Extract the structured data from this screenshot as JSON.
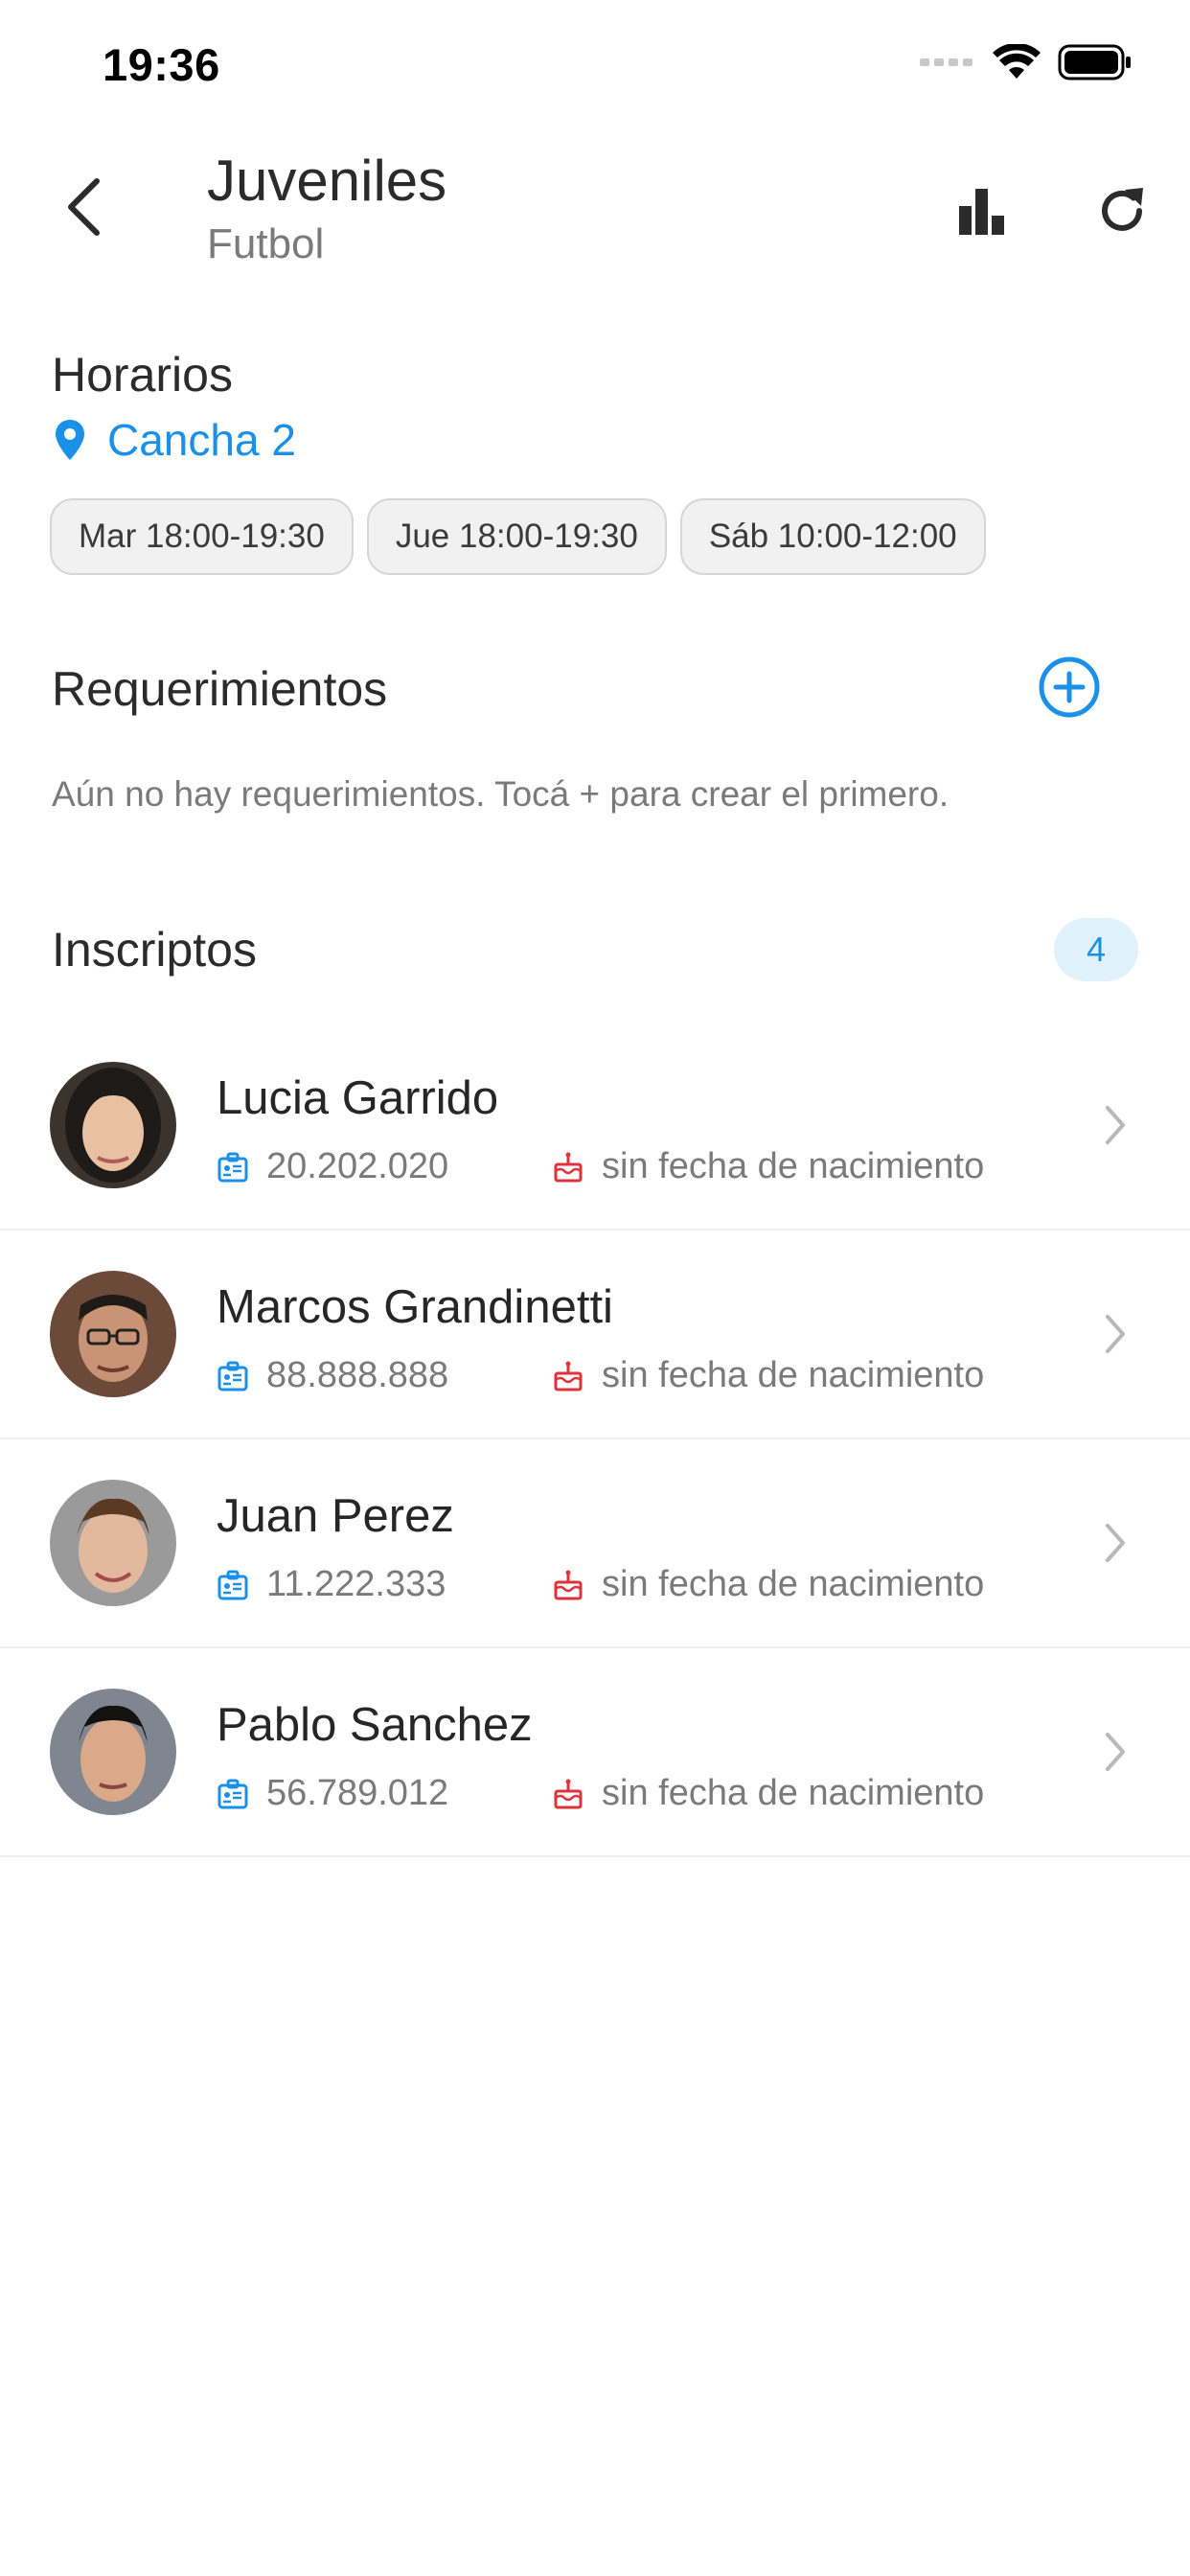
{
  "status_bar": {
    "time": "19:36"
  },
  "header": {
    "title": "Juveniles",
    "subtitle": "Futbol",
    "back_icon": "chevron-left-icon",
    "stats_icon": "bar-chart-icon",
    "refresh_icon": "refresh-icon"
  },
  "horarios": {
    "title": "Horarios",
    "location": "Cancha 2",
    "slots": [
      "Mar 18:00-19:30",
      "Jue 18:00-19:30",
      "Sáb 10:00-12:00"
    ]
  },
  "requerimientos": {
    "title": "Requerimientos",
    "empty_message": "Aún no hay requerimientos. Tocá + para crear el primero.",
    "add_icon": "add-circle-icon"
  },
  "inscriptos": {
    "title": "Inscriptos",
    "count": "4",
    "members": [
      {
        "name": "Lucia Garrido",
        "dni": "20.202.020",
        "birthdate": "sin fecha de nacimiento"
      },
      {
        "name": "Marcos Grandinetti",
        "dni": "88.888.888",
        "birthdate": "sin fecha de nacimiento"
      },
      {
        "name": "Juan Perez",
        "dni": "11.222.333",
        "birthdate": "sin fecha de nacimiento"
      },
      {
        "name": "Pablo Sanchez",
        "dni": "56.789.012",
        "birthdate": "sin fecha de nacimiento"
      }
    ]
  },
  "colors": {
    "accent": "#1a90e8",
    "birthday_icon": "#e0323a",
    "badge_bg": "#e1f1fc"
  }
}
